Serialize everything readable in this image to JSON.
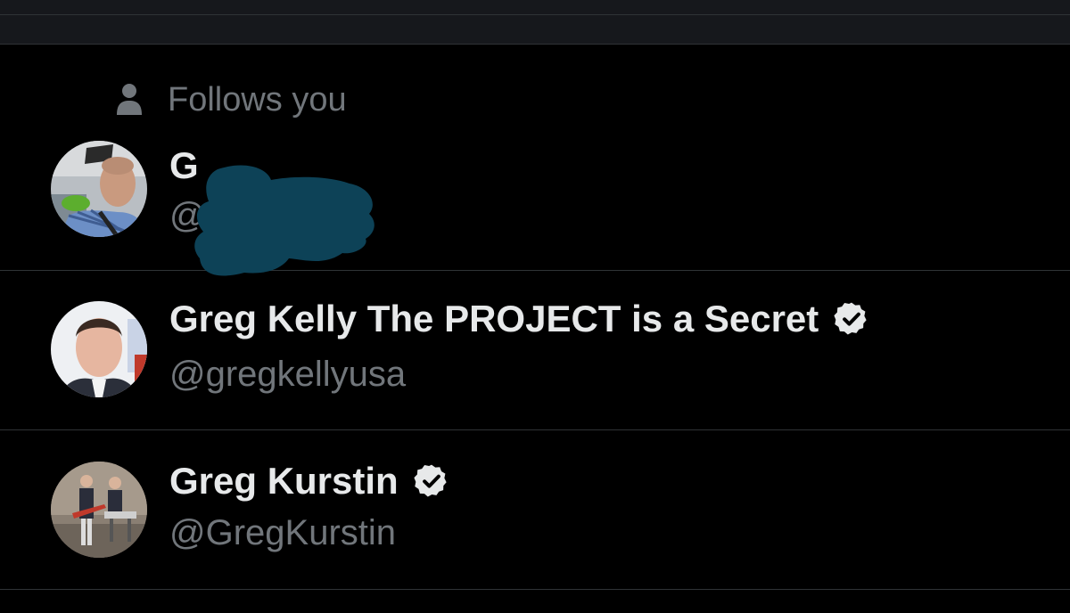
{
  "follows_you_label": "Follows you",
  "accounts": [
    {
      "name_visible": "G",
      "handle_visible": "@",
      "redacted": true,
      "avatar": "photo-man-bald-plaid-shirt"
    },
    {
      "name": "Greg Kelly The PROJECT is a Secret",
      "handle": "@gregkellyusa",
      "verified": true,
      "avatar": "photo-man-suit"
    },
    {
      "name": "Greg Kurstin",
      "handle": "@GregKurstin",
      "verified": true,
      "avatar": "photo-band-on-stage"
    }
  ],
  "icons": {
    "follows": "person-icon",
    "verified": "verified-badge-icon"
  },
  "colors": {
    "background": "#000000",
    "top_bar": "#16181c",
    "divider": "#2f3336",
    "primary_text": "#e7e9ea",
    "secondary_text": "#71767b",
    "redaction": "#0d4257"
  }
}
